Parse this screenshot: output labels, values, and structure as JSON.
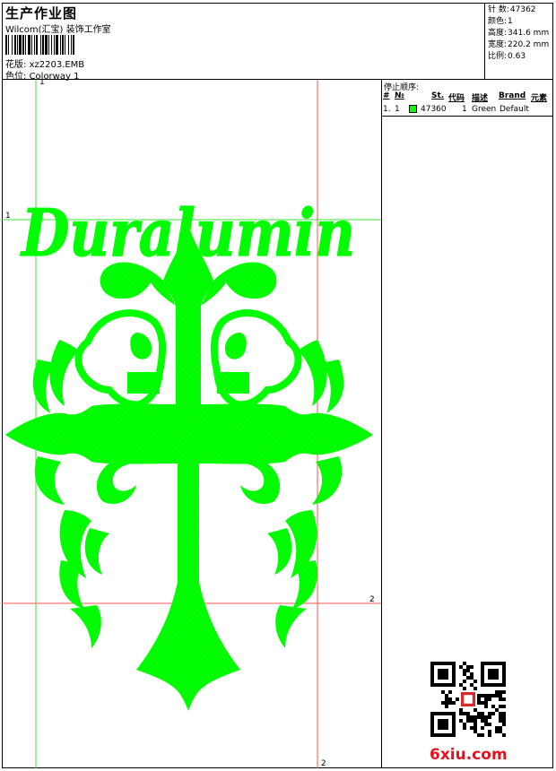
{
  "header": {
    "title": "生产作业图",
    "company": "Wilcom(汇宝) 装饰工作室",
    "design_label": "花版:",
    "design_value": "xz2203.EMB",
    "colorway_label": "色位:",
    "colorway_value": "Colorway 1"
  },
  "stats": [
    {
      "label": "针 数:",
      "value": "47362"
    },
    {
      "label": "颜色:",
      "value": "1"
    },
    {
      "label": "高度:",
      "value": "341.6 mm"
    },
    {
      "label": "宽度:",
      "value": "220.2 mm"
    },
    {
      "label": "比例:",
      "value": "0.63"
    }
  ],
  "stop_sequence": {
    "title": "停止顺序:",
    "columns": [
      "#",
      "№",
      "St.",
      "代码",
      "描述",
      "Brand",
      "元素"
    ],
    "rows": [
      {
        "index": "1.",
        "no": "1",
        "stitches": "47360",
        "code": "1",
        "description": "Green",
        "brand": "Default",
        "color": "#00ff00"
      }
    ]
  },
  "guides": {
    "top_left": "1",
    "left_mid": "1",
    "right_mid": "2",
    "bottom": "2"
  },
  "artwork": {
    "text": "Duralumin",
    "color": "#00ff00"
  },
  "watermark": "6xiu.com",
  "qr_icon": "qr-code-icon"
}
